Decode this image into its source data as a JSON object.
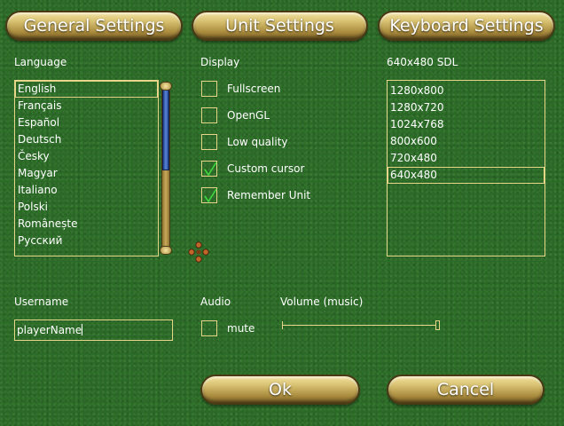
{
  "tabs": {
    "general": "General Settings",
    "unit": "Unit Settings",
    "keyboard": "Keyboard Settings"
  },
  "language": {
    "label": "Language",
    "items": [
      "English",
      "Français",
      "Español",
      "Deutsch",
      "Česky",
      "Magyar",
      "Italiano",
      "Polski",
      "Românește",
      "Русский"
    ],
    "selected": "English"
  },
  "display": {
    "label": "Display",
    "options": [
      {
        "label": "Fullscreen",
        "checked": false
      },
      {
        "label": "OpenGL",
        "checked": false
      },
      {
        "label": "Low quality",
        "checked": false
      },
      {
        "label": "Custom cursor",
        "checked": true
      },
      {
        "label": "Remember Unit",
        "checked": true
      }
    ]
  },
  "resolution": {
    "label": "640x480 SDL",
    "items": [
      "1280x800",
      "1280x720",
      "1024x768",
      "800x600",
      "720x480",
      "640x480"
    ],
    "selected": "640x480"
  },
  "username": {
    "label": "Username",
    "value": "playerName"
  },
  "audio": {
    "label": "Audio",
    "mute_label": "mute",
    "mute_checked": false,
    "volume_label": "Volume (music)",
    "volume": 1.0
  },
  "buttons": {
    "ok": "Ok",
    "cancel": "Cancel"
  },
  "colors": {
    "background": "#2a6a26",
    "gold_border": "#e7d58a",
    "check": "#3fd83f"
  }
}
